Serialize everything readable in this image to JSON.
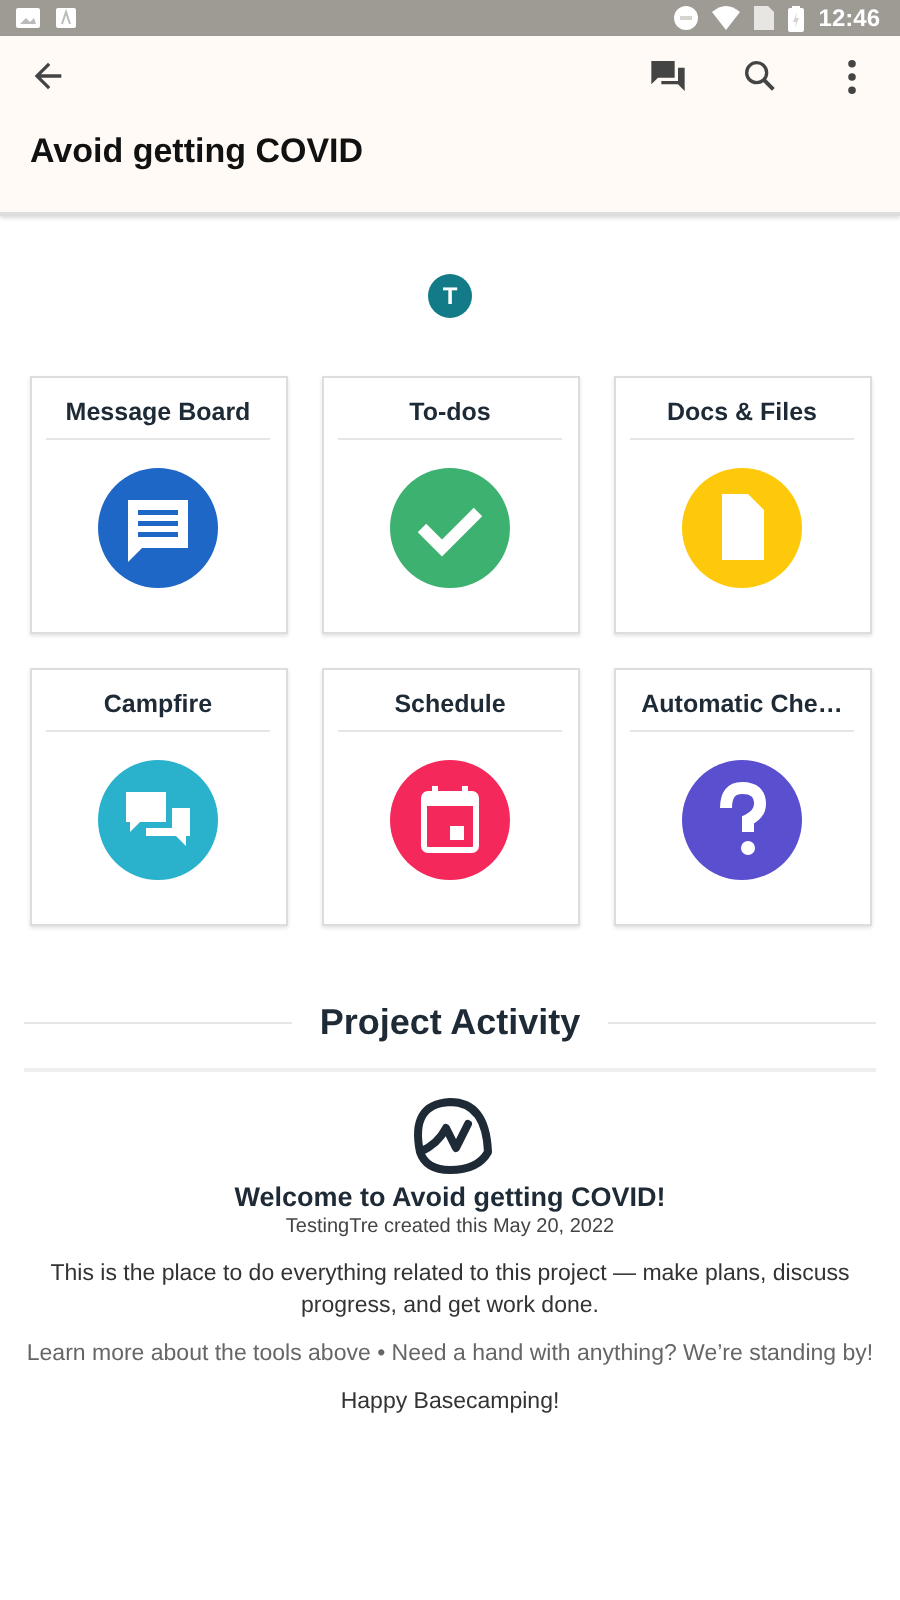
{
  "status_bar": {
    "time": "12:46"
  },
  "app_bar": {
    "title": "Avoid getting COVID"
  },
  "avatar": {
    "initial": "T"
  },
  "tools": [
    {
      "label": "Message Board",
      "kind": "message",
      "color": "#1f67c6"
    },
    {
      "label": "To-dos",
      "kind": "todos",
      "color": "#3db16f"
    },
    {
      "label": "Docs & Files",
      "kind": "docs",
      "color": "#fdc90a"
    },
    {
      "label": "Campfire",
      "kind": "campfire",
      "color": "#2ab1cb"
    },
    {
      "label": "Schedule",
      "kind": "schedule",
      "color": "#f4285a"
    },
    {
      "label": "Automatic Che…",
      "kind": "question",
      "color": "#5a4fcf"
    }
  ],
  "activity": {
    "heading": "Project Activity",
    "welcome": "Welcome to Avoid getting COVID!",
    "created": "TestingTre created this May 20, 2022",
    "intro": "This is the place to do everything related to this project — make plans, discuss progress, and get work done.",
    "help": "Learn more about the tools above • Need a hand with anything? We’re standing by!",
    "signoff": "Happy Basecamping!"
  }
}
